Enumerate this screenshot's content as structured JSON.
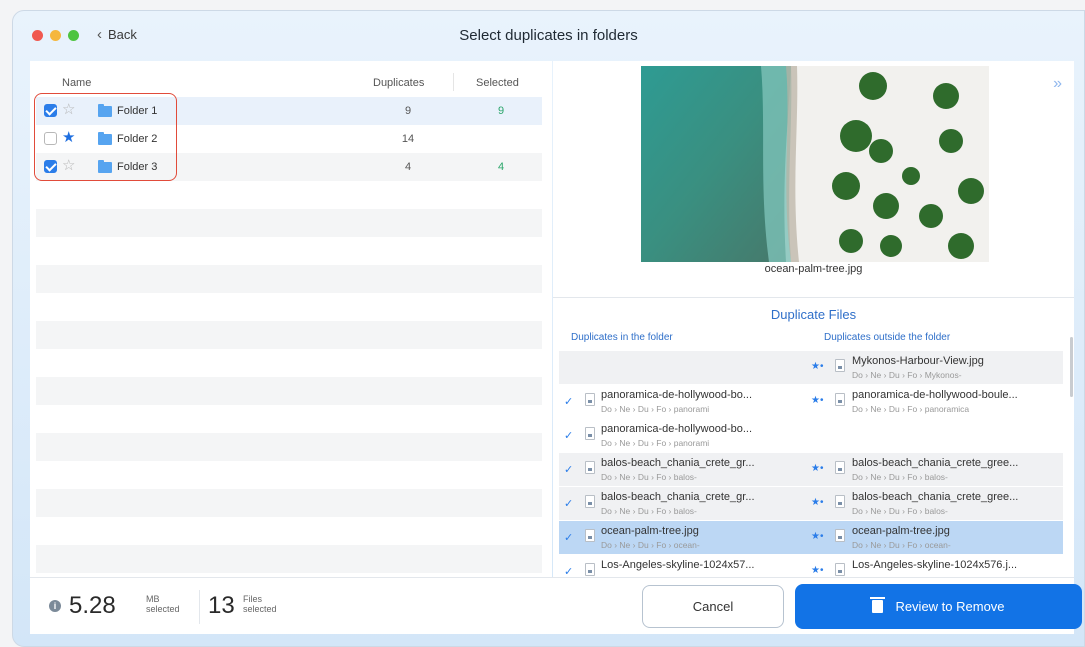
{
  "window": {
    "title": "Select duplicates in folders",
    "back_label": "Back"
  },
  "folders": {
    "columns": {
      "name": "Name",
      "duplicates": "Duplicates",
      "selected": "Selected"
    },
    "rows": [
      {
        "name": "Folder 1",
        "checked": true,
        "starred": false,
        "duplicates": "9",
        "selected": "9"
      },
      {
        "name": "Folder 2",
        "checked": false,
        "starred": true,
        "duplicates": "14",
        "selected": ""
      },
      {
        "name": "Folder 3",
        "checked": true,
        "starred": false,
        "duplicates": "4",
        "selected": "4"
      }
    ]
  },
  "preview": {
    "file_name": "ocean-palm-tree.jpg"
  },
  "duplicate_files": {
    "title": "Duplicate Files",
    "col_in": "Duplicates in the folder",
    "col_out": "Duplicates outside the folder",
    "rows": [
      {
        "in": null,
        "out": {
          "name": "Mykonos-Harbour-View.jpg",
          "path": "Do › Ne › Du › Fo › Mykonos-"
        }
      },
      {
        "in": {
          "name": "panoramica-de-hollywood-bo...",
          "path": "Do › Ne › Du › Fo › panorami"
        },
        "out": {
          "name": "panoramica-de-hollywood-boule...",
          "path": "Do › Ne › Du › Fo › panoramica"
        }
      },
      {
        "in": {
          "name": "panoramica-de-hollywood-bo...",
          "path": "Do › Ne › Du › Fo › panorami"
        },
        "out": null
      },
      {
        "in": {
          "name": "balos-beach_chania_crete_gr...",
          "path": "Do › Ne › Du › Fo › balos-"
        },
        "out": {
          "name": "balos-beach_chania_crete_gree...",
          "path": "Do › Ne › Du › Fo › balos-"
        }
      },
      {
        "in": {
          "name": "balos-beach_chania_crete_gr...",
          "path": "Do › Ne › Du › Fo › balos-"
        },
        "out": {
          "name": "balos-beach_chania_crete_gree...",
          "path": "Do › Ne › Du › Fo › balos-"
        }
      },
      {
        "in": {
          "name": "ocean-palm-tree.jpg",
          "path": "Do › Ne › Du › Fo › ocean-"
        },
        "out": {
          "name": "ocean-palm-tree.jpg",
          "path": "Do › Ne › Du › Fo › ocean-"
        }
      },
      {
        "in": {
          "name": "Los-Angeles-skyline-1024x57...",
          "path": ""
        },
        "out": {
          "name": "Los-Angeles-skyline-1024x576.j...",
          "path": ""
        }
      }
    ]
  },
  "summary": {
    "size_value": "5.28",
    "size_unit": "MB",
    "size_caption": "selected",
    "files_value": "13",
    "files_unit": "Files",
    "files_caption": "selected"
  },
  "actions": {
    "cancel": "Cancel",
    "review": "Review to Remove"
  },
  "colors": {
    "accent": "#1273e6",
    "highlight": "#e14b3a",
    "selected_count": "#2aa56a"
  }
}
